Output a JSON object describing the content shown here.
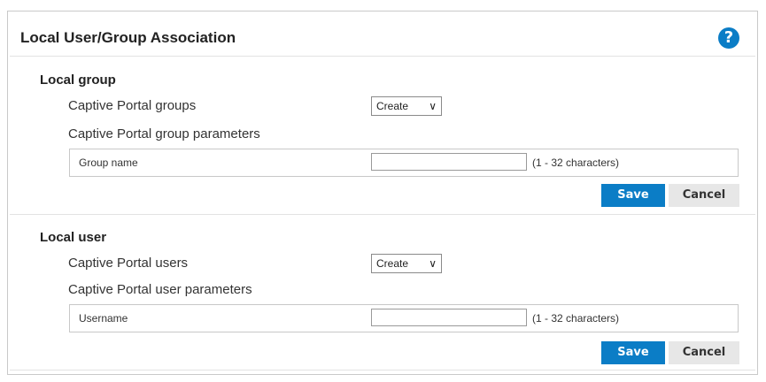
{
  "panel": {
    "title": "Local User/Group Association",
    "help_symbol": "?"
  },
  "group": {
    "title": "Local group",
    "list_label": "Captive Portal groups",
    "select_value": "Create",
    "params_label": "Captive Portal group parameters",
    "field_label": "Group name",
    "field_value": "",
    "field_hint": "(1 - 32 characters)",
    "save_label": "Save",
    "cancel_label": "Cancel"
  },
  "user": {
    "title": "Local user",
    "list_label": "Captive Portal users",
    "select_value": "Create",
    "params_label": "Captive Portal user parameters",
    "field_label": "Username",
    "field_value": "",
    "field_hint": "(1 - 32 characters)",
    "save_label": "Save",
    "cancel_label": "Cancel"
  },
  "icons": {
    "help": "help-icon",
    "dropdown": "chevron-down-icon"
  },
  "colors": {
    "accent": "#0b7dc6",
    "cancel_bg": "#e7e7e7",
    "border": "#c9c9c9"
  }
}
